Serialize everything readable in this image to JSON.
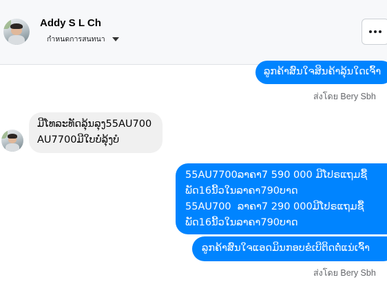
{
  "header": {
    "name": "Addy S L Ch",
    "subtitle": "กำหนดการสนทนา",
    "more_label": "more-options"
  },
  "messages": [
    {
      "direction": "outgoing",
      "text": "ລູກຄ້າສົນໃຈສິນຄ້າລຸ້ນໃດເຈົ້າ"
    },
    {
      "direction": "incoming",
      "text": "ມີໂທລະທັດລຸ້ນລຸງ55AU700\nAU7700ມີໃບບໍ່ລຸ້ງບໍ"
    },
    {
      "direction": "outgoing",
      "text": "55AU7700ລາຄາ7 590 000 ມີໂປຣແຖມຊື້\nພັດ16ນີ້ວໃນລາຄາ790ບາດ\n55AU700  ລາຄາ7 290 000ມີໂປຣແຖມຊື້\nພັດ16ນີ້ວໃນລາຄາ790ບາດ"
    },
    {
      "direction": "outgoing",
      "text": "ລູກຄ້າສົນໃຈແອດມິນກອບຂໍເບີຕິດຕໍ່ແນ່ເຈົ້າ"
    }
  ],
  "sent_by": [
    "ส่งโดย Bery Sbh",
    "ส่งโดย Bery Sbh"
  ],
  "colors": {
    "outgoing_bubble": "#0084ff",
    "incoming_bubble": "#f0f0f0",
    "header_bg": "#f7f8fa"
  }
}
